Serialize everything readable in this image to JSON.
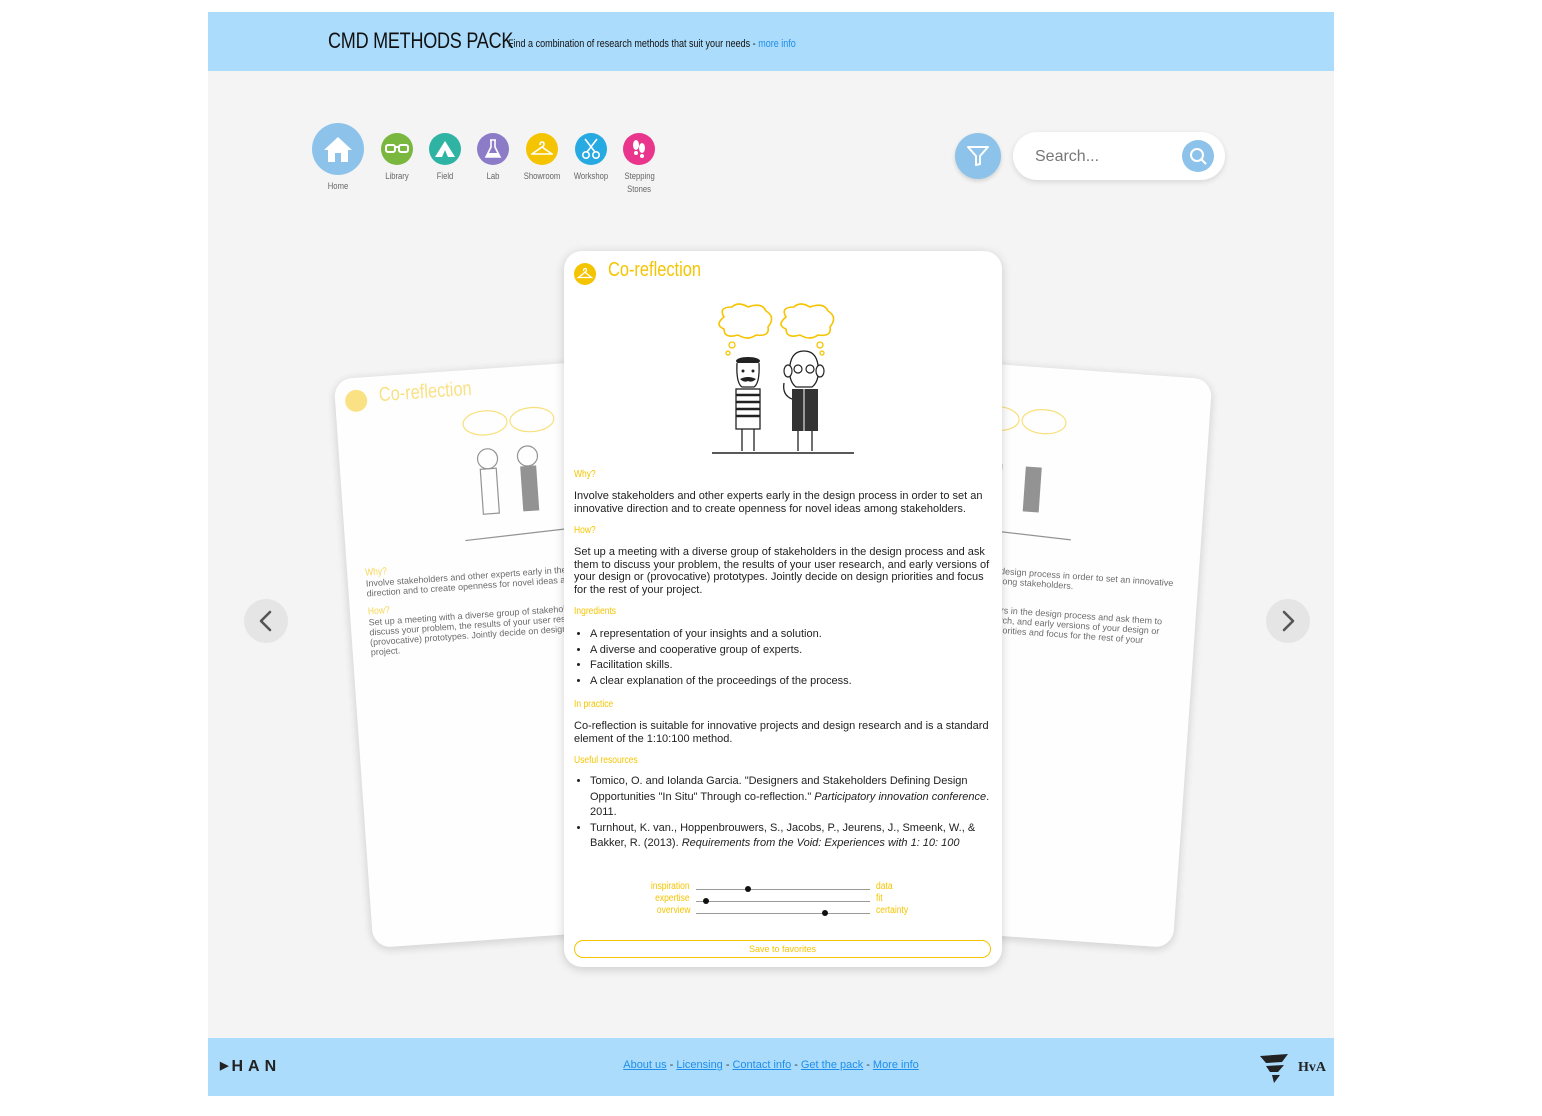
{
  "header": {
    "title": "CMD METHODS PACK",
    "tagline": "Find a combination of research methods that suit your needs - ",
    "more_info_link": "more info"
  },
  "nav": [
    {
      "label": "Home",
      "icon": "home-icon",
      "color": "#8dc3ea"
    },
    {
      "label": "Library",
      "icon": "glasses-icon",
      "color": "#7ab73f"
    },
    {
      "label": "Field",
      "icon": "tent-icon",
      "color": "#2fb4a4"
    },
    {
      "label": "Lab",
      "icon": "flask-icon",
      "color": "#8c7cc8"
    },
    {
      "label": "Showroom",
      "icon": "hanger-icon",
      "color": "#f5c400"
    },
    {
      "label": "Workshop",
      "icon": "scissors-icon",
      "color": "#27a9e1"
    },
    {
      "label": "Stepping Stones",
      "icon": "footsteps-icon",
      "color": "#e9368c"
    }
  ],
  "search": {
    "placeholder": "Search..."
  },
  "card": {
    "title": "Co-reflection",
    "why_heading": "Why?",
    "why_text": "Involve stakeholders and other experts early in the design process in order to set an innovative direction and to create openness for novel ideas among stakeholders.",
    "how_heading": "How?",
    "how_text": "Set up a meeting with a diverse group of stakeholders in the design process and ask them to discuss your problem, the results of your user research, and early versions of your design or (provocative) prototypes. Jointly decide on design priorities and focus for the rest of your project.",
    "ingredients_heading": "Ingredients",
    "ingredients": [
      "A representation of your insights and a solution.",
      "A diverse and cooperative group of experts.",
      "Facilitation skills.",
      "A clear explanation of the proceedings of the process."
    ],
    "practice_heading": "In practice",
    "practice_text": "Co-reflection is suitable for innovative projects and design research and is a standard element of the 1:10:100 method.",
    "resources_heading": "Useful resources",
    "resource_1_plain": "Tomico, O. and Iolanda Garcia. \"Designers and Stakeholders Defining Design Opportunities \"In Situ\" Through co-reflection.\" ",
    "resource_1_italic": "Participatory innovation conference",
    "resource_1_tail": ". 2011.",
    "resource_2_plain": "Turnhout, K. van., Hoppenbrouwers, S., Jacobs, P., Jeurens, J., Smeenk, W., & Bakker, R. (2013). ",
    "resource_2_italic": "Requirements from the Void: Experiences with 1: 10: 100",
    "sliders": [
      {
        "left": "inspiration",
        "right": "data",
        "value": 0.3
      },
      {
        "left": "expertise",
        "right": "fit",
        "value": 0.06
      },
      {
        "left": "overview",
        "right": "certainty",
        "value": 0.74
      }
    ],
    "favorite_label": "Save to favorites"
  },
  "footer": {
    "links": [
      "About us",
      "Licensing",
      "Contact info",
      "Get the pack",
      "More info"
    ],
    "left_logo": "HAN",
    "right_logo": "HvA"
  }
}
